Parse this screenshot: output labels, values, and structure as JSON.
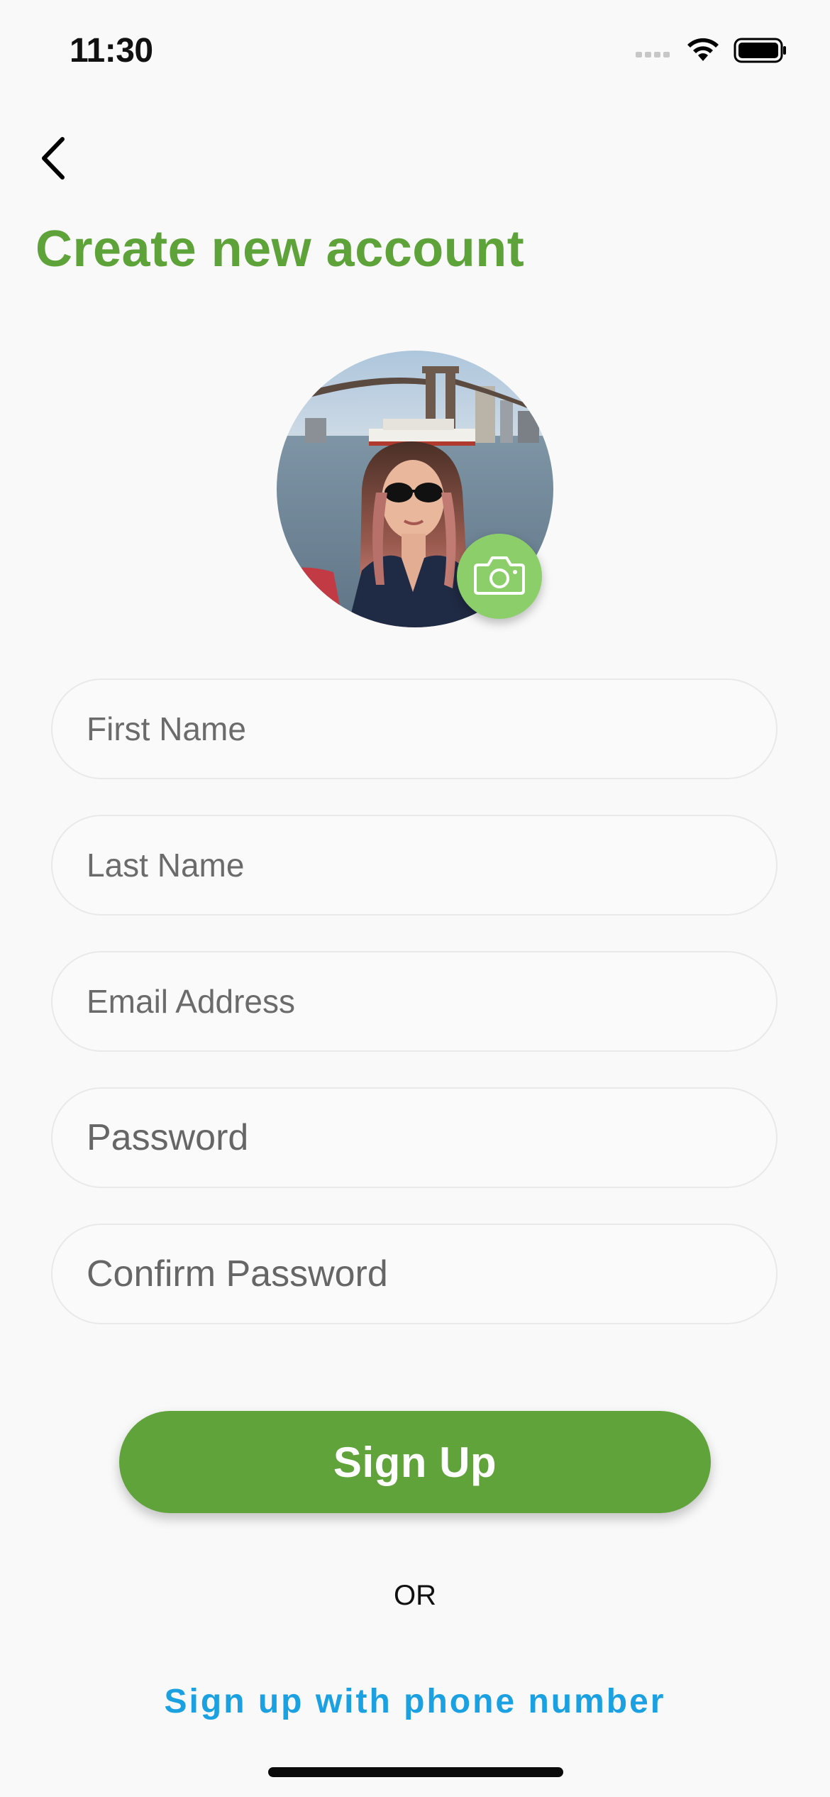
{
  "status_bar": {
    "time": "11:30",
    "icons": [
      "signal-icon",
      "wifi-icon",
      "battery-icon"
    ]
  },
  "header": {
    "back_icon": "chevron-left-icon",
    "title": "Create new account"
  },
  "avatar": {
    "camera_icon": "camera-icon"
  },
  "form": {
    "first_name": {
      "placeholder": "First Name",
      "value": ""
    },
    "last_name": {
      "placeholder": "Last Name",
      "value": ""
    },
    "email": {
      "placeholder": "Email Address",
      "value": ""
    },
    "password": {
      "placeholder": "Password",
      "value": ""
    },
    "confirm_password": {
      "placeholder": "Confirm Password",
      "value": ""
    }
  },
  "actions": {
    "signup_label": "Sign Up",
    "or_label": "OR",
    "phone_link": "Sign up with phone number"
  },
  "colors": {
    "accent_green": "#5fa33a",
    "title_green": "#5ea33a",
    "camera_green": "#8ccf6a",
    "link_blue": "#1ba1e2",
    "background": "#f9f9f9"
  }
}
